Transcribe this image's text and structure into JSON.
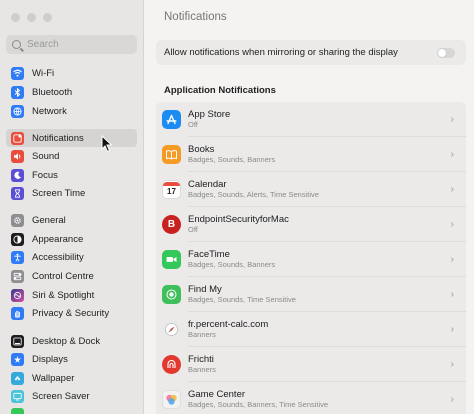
{
  "search": {
    "placeholder": "Search"
  },
  "sidebar": {
    "items": [
      {
        "label": "Wi-Fi",
        "icon": "wifi-icon",
        "color": "#2f7cf6"
      },
      {
        "label": "Bluetooth",
        "icon": "bluetooth-icon",
        "color": "#2f7cf6"
      },
      {
        "label": "Network",
        "icon": "network-icon",
        "color": "#2f7cf6"
      },
      {
        "label": "Notifications",
        "icon": "notifications-icon",
        "color": "#eb4d3d"
      },
      {
        "label": "Sound",
        "icon": "sound-icon",
        "color": "#eb4d3d"
      },
      {
        "label": "Focus",
        "icon": "focus-icon",
        "color": "#5b4fd6"
      },
      {
        "label": "Screen Time",
        "icon": "screen-time-icon",
        "color": "#5b4fd6"
      },
      {
        "label": "General",
        "icon": "gear-icon",
        "color": "#8e8e93"
      },
      {
        "label": "Appearance",
        "icon": "appearance-icon",
        "color": "#1d1d1f"
      },
      {
        "label": "Accessibility",
        "icon": "accessibility-icon",
        "color": "#2f7cf6"
      },
      {
        "label": "Control Centre",
        "icon": "control-centre-icon",
        "color": "#8e8e93"
      },
      {
        "label": "Siri & Spotlight",
        "icon": "siri-icon",
        "color": "#b44fd6"
      },
      {
        "label": "Privacy & Security",
        "icon": "hand-icon",
        "color": "#2f7cf6"
      },
      {
        "label": "Desktop & Dock",
        "icon": "dock-icon",
        "color": "#1d1d1f"
      },
      {
        "label": "Displays",
        "icon": "displays-icon",
        "color": "#2f7cf6"
      },
      {
        "label": "Wallpaper",
        "icon": "wallpaper-icon",
        "color": "#34aadc"
      },
      {
        "label": "Screen Saver",
        "icon": "screen-saver-icon",
        "color": "#4cc3d9"
      }
    ],
    "selected": "Notifications"
  },
  "main": {
    "title": "Notifications",
    "mirror_label": "Allow notifications when mirroring or sharing the display",
    "mirror_on": false,
    "section_title": "Application Notifications",
    "apps": [
      {
        "name": "App Store",
        "sub": "Off",
        "icon": "app-store-icon",
        "color": "#1c8cf2"
      },
      {
        "name": "Books",
        "sub": "Badges, Sounds, Banners",
        "icon": "books-icon",
        "color": "#f59a23"
      },
      {
        "name": "Calendar",
        "sub": "Badges, Sounds, Alerts, Time Sensitive",
        "icon": "calendar-icon",
        "color": "#ffffff",
        "glyph": "17"
      },
      {
        "name": "EndpointSecurityforMac",
        "sub": "Off",
        "icon": "endpoint-security-icon",
        "color": "#c8211f",
        "glyph": "B"
      },
      {
        "name": "FaceTime",
        "sub": "Badges, Sounds, Banners",
        "icon": "facetime-icon",
        "color": "#34c759"
      },
      {
        "name": "Find My",
        "sub": "Badges, Sounds, Time Sensitive",
        "icon": "find-my-icon",
        "color": "#3fbf5a"
      },
      {
        "name": "fr.percent-calc.com",
        "sub": "Banners",
        "icon": "safari-icon",
        "color": "#e9e9ea"
      },
      {
        "name": "Frichti",
        "sub": "Banners",
        "icon": "frichti-icon",
        "color": "#e1392e"
      },
      {
        "name": "Game Center",
        "sub": "Badges, Sounds, Banners, Time Sensitive",
        "icon": "game-center-icon",
        "color": "#f2f2f2"
      }
    ]
  }
}
